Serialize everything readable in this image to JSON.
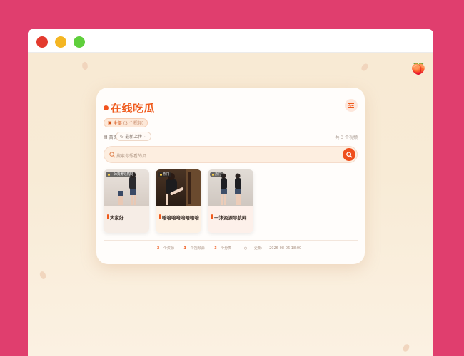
{
  "window": {
    "controls": [
      "close",
      "minimize",
      "maximize"
    ]
  },
  "app": {
    "title": "在线吃瓜",
    "accent_color": "#ef5a1c"
  },
  "filters": {
    "all_label": "全部",
    "all_count": "(3 个视频)",
    "category_label": "首页",
    "sort_label": "最新上传",
    "result_text": "共 3 个视频"
  },
  "search": {
    "placeholder": "搜索你想看的瓜..."
  },
  "videos": [
    {
      "tag": "一沐资源导航网",
      "title": "大家好",
      "bg": "#e4dcd6"
    },
    {
      "tag": "热门",
      "title": "哈哈哈哈哈哈哈哈",
      "bg": "#3a2a20"
    },
    {
      "tag": "热门",
      "title": "一沐资源导航网",
      "bg": "#dcd6d0"
    }
  ],
  "footer": {
    "videos_count": "3",
    "videos_label": "个资源",
    "views_count": "3",
    "views_label": "个视频源",
    "categories_count": "3",
    "categories_label": "个分类",
    "updated_label": "更新:",
    "updated_value": "2026-08-06 18:00"
  },
  "icons": {
    "menu": "sliders-icon",
    "search": "search-icon",
    "clock": "clock-icon",
    "peach": "peach-icon"
  }
}
